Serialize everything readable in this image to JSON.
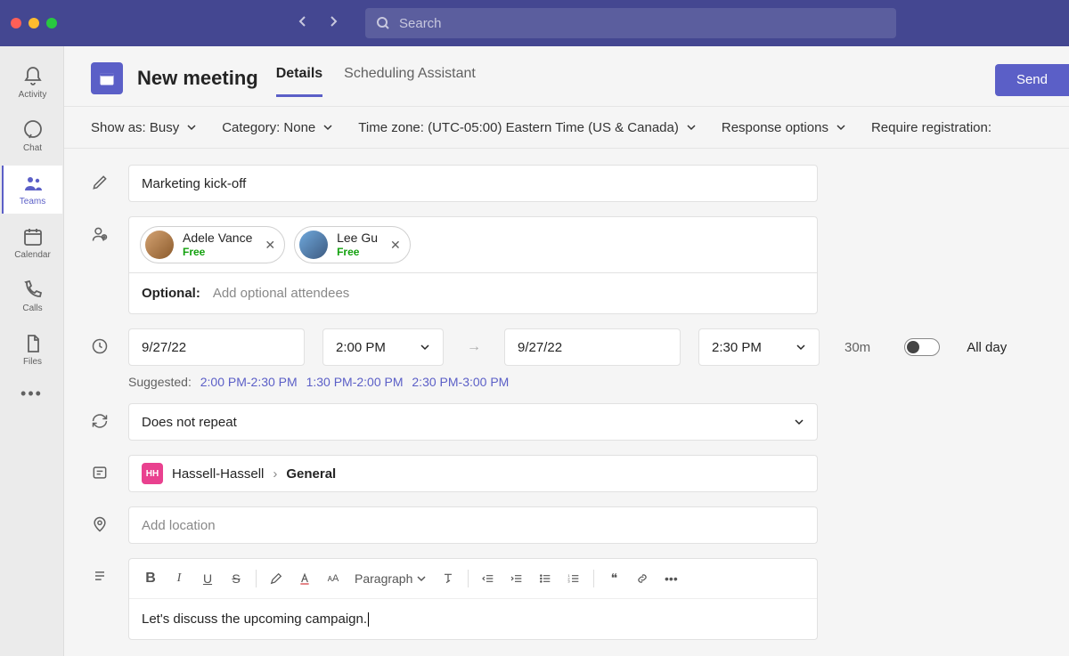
{
  "titlebar": {
    "search_placeholder": "Search"
  },
  "rail": {
    "items": [
      {
        "label": "Activity"
      },
      {
        "label": "Chat"
      },
      {
        "label": "Teams"
      },
      {
        "label": "Calendar"
      },
      {
        "label": "Calls"
      },
      {
        "label": "Files"
      }
    ]
  },
  "header": {
    "title": "New meeting",
    "tabs": [
      {
        "label": "Details"
      },
      {
        "label": "Scheduling Assistant"
      }
    ],
    "send_label": "Send"
  },
  "options": {
    "show_as": "Show as: Busy",
    "category": "Category: None",
    "timezone": "Time zone: (UTC-05:00) Eastern Time (US & Canada)",
    "response": "Response options",
    "registration": "Require registration:"
  },
  "form": {
    "title_value": "Marketing kick-off",
    "attendees": [
      {
        "name": "Adele Vance",
        "status": "Free"
      },
      {
        "name": "Lee Gu",
        "status": "Free"
      }
    ],
    "optional_label": "Optional:",
    "optional_placeholder": "Add optional attendees",
    "start_date": "9/27/22",
    "start_time": "2:00 PM",
    "end_date": "9/27/22",
    "end_time": "2:30 PM",
    "duration": "30m",
    "all_day_label": "All day",
    "suggested_label": "Suggested:",
    "suggestions": [
      "2:00 PM-2:30 PM",
      "1:30 PM-2:00 PM",
      "2:30 PM-3:00 PM"
    ],
    "repeat": "Does not repeat",
    "team_badge": "HH",
    "team_name": "Hassell-Hassell",
    "channel_name": "General",
    "location_placeholder": "Add location",
    "paragraph_label": "Paragraph",
    "description": "Let's discuss the upcoming campaign."
  }
}
